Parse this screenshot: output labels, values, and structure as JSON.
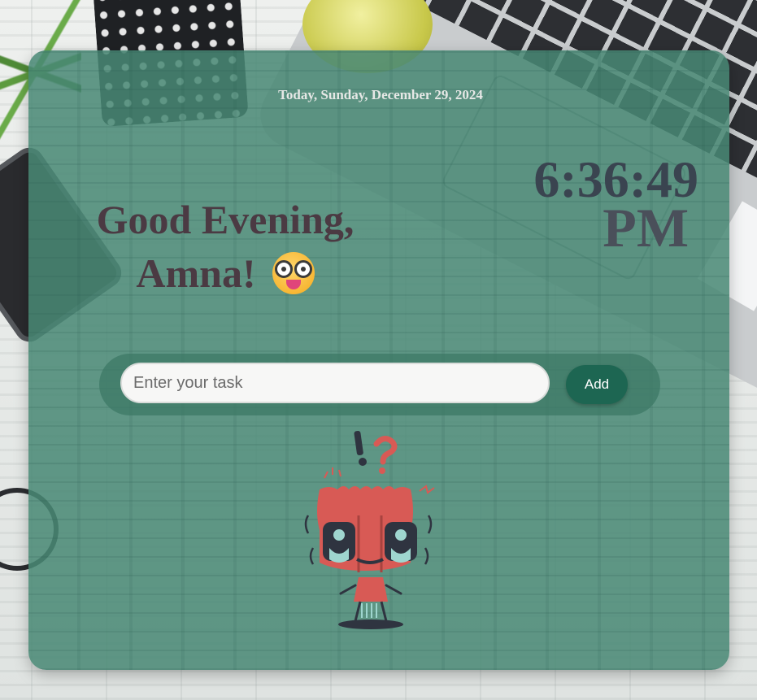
{
  "header": {
    "date_text": "Today, Sunday, December 29, 2024"
  },
  "greeting": {
    "line1": "Good Evening,",
    "line2": "Amna!"
  },
  "clock": {
    "time": "6:36:49",
    "ampm": "PM"
  },
  "task_entry": {
    "placeholder": "Enter your task",
    "value": "",
    "add_label": "Add"
  },
  "icons": {
    "emoji": "nerd-face-emoji-icon",
    "illustration": "confused-creature-illustration-icon"
  },
  "colors": {
    "card": "#488874",
    "add_button": "#1d6652",
    "greeting_text": "#4b3a43",
    "clock_text": "#3a4450"
  }
}
